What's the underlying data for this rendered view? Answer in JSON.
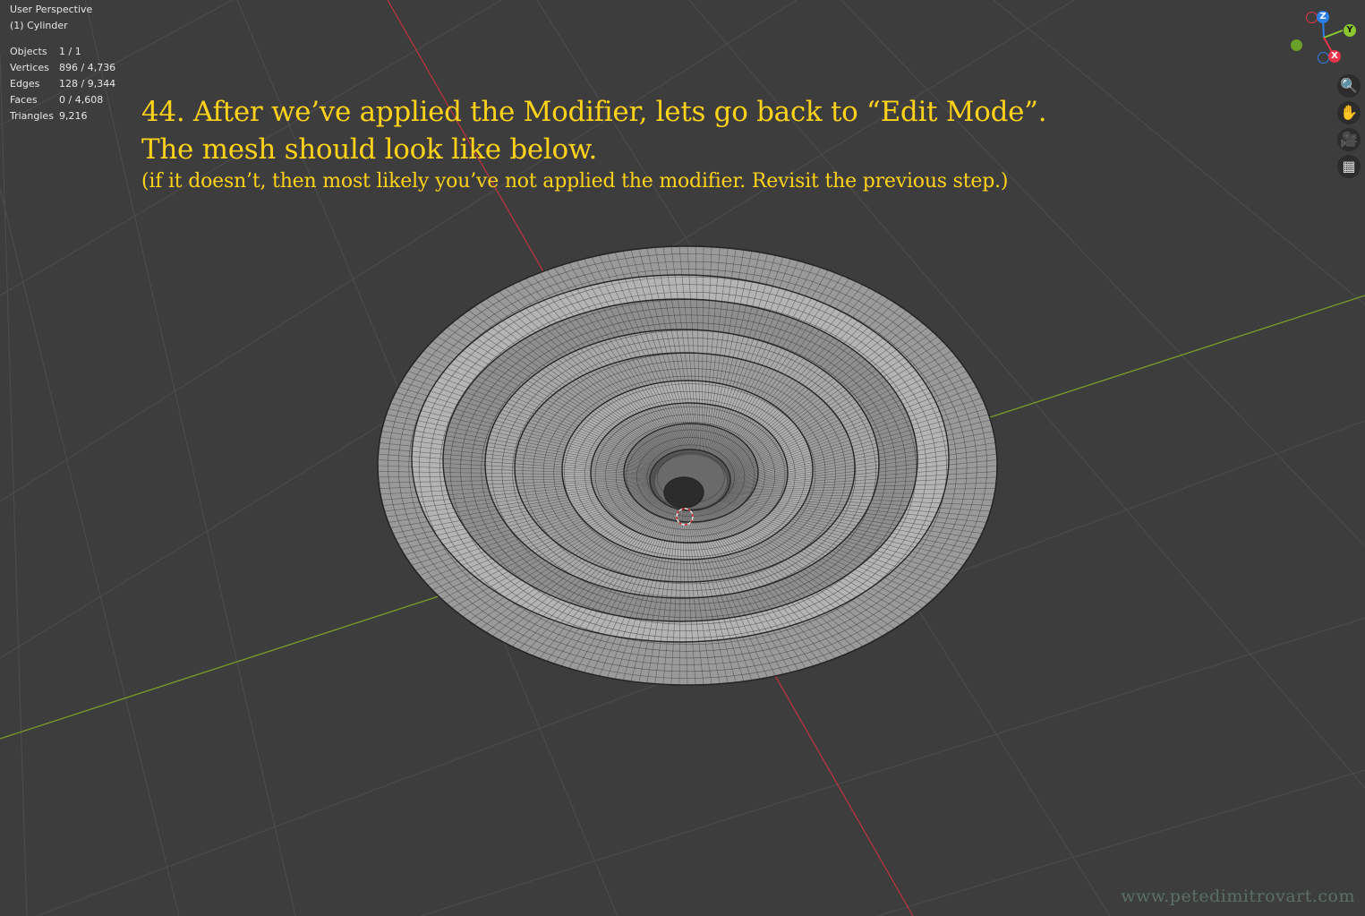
{
  "viewport": {
    "view_name": "User Perspective",
    "object_name": "(1) Cylinder",
    "stats": [
      {
        "label": "Objects",
        "value": "1 / 1"
      },
      {
        "label": "Vertices",
        "value": "896 / 4,736"
      },
      {
        "label": "Edges",
        "value": "128 / 9,344"
      },
      {
        "label": "Faces",
        "value": "0 / 4,608"
      },
      {
        "label": "Triangles",
        "value": "9,216"
      }
    ]
  },
  "tutorial": {
    "line1": "44. After we’ve applied the Modifier, lets go back to “Edit Mode”.",
    "line2": "The mesh should look like below.",
    "line3": "(if it doesn’t, then most likely you’ve not applied the modifier. Revisit the previous step.)"
  },
  "gizmo": {
    "x_label": "X",
    "y_label": "Y",
    "z_label": "Z",
    "colors": {
      "x": "#e8344a",
      "y": "#8bc72e",
      "z": "#2d7fe6"
    }
  },
  "nav_buttons": [
    {
      "name": "zoom-icon",
      "glyph": "🔍"
    },
    {
      "name": "pan-hand-icon",
      "glyph": "✋"
    },
    {
      "name": "camera-icon",
      "glyph": "🎥"
    },
    {
      "name": "grid-ortho-icon",
      "glyph": "▦"
    }
  ],
  "colors": {
    "background": "#3d3d3d",
    "tutorial_text": "#ffd21a",
    "x_axis": "#c0373f",
    "y_axis": "#7ea22a"
  },
  "watermark": "www.petedimitrovart.com"
}
